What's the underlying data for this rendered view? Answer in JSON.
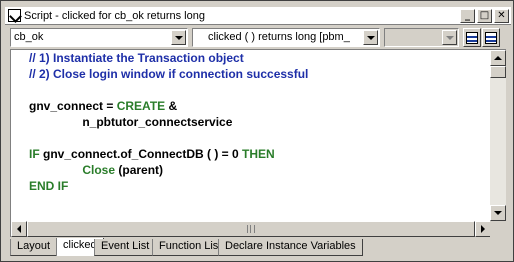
{
  "window": {
    "title": "Script - clicked for cb_ok returns long",
    "controls": {
      "minimize": "_",
      "maximize": "□",
      "close": "✕"
    }
  },
  "selectors": {
    "object": "cb_ok",
    "event": "clicked ( )  returns long [pbm_",
    "third": ""
  },
  "code": {
    "lines": [
      {
        "text": "// 1) Instantiate the Transaction object",
        "style": "comment"
      },
      {
        "text": "// 2) Close login window if connection successful",
        "style": "comment"
      },
      {
        "text": "",
        "style": "plain"
      },
      {
        "parts": [
          {
            "text": "gnv_connect = ",
            "style": "plain"
          },
          {
            "text": "CREATE",
            "style": "kw"
          },
          {
            "text": " &",
            "style": "plain"
          }
        ]
      },
      {
        "text": "                n_pbtutor_connectservice",
        "style": "plain"
      },
      {
        "text": "",
        "style": "plain"
      },
      {
        "parts": [
          {
            "text": "IF",
            "style": "kw"
          },
          {
            "text": " gnv_connect.of_ConnectDB ( ) = 0 ",
            "style": "plain"
          },
          {
            "text": "THEN",
            "style": "kw"
          }
        ]
      },
      {
        "parts": [
          {
            "text": "                Close",
            "style": "kw"
          },
          {
            "text": " (parent)",
            "style": "plain"
          }
        ]
      },
      {
        "text": "END IF",
        "style": "kw"
      }
    ]
  },
  "tabs": [
    {
      "label": "Layout",
      "active": false
    },
    {
      "label": "clicked",
      "active": true
    },
    {
      "label": "Event List",
      "active": false
    },
    {
      "label": "Function List",
      "active": false
    },
    {
      "label": "Declare Instance Variables",
      "active": false
    }
  ],
  "colors": {
    "comment": "#1e2fa8",
    "keyword": "#2a7d2a",
    "plain": "#000000",
    "chrome": "#d4d0c8"
  },
  "icons": {
    "window": "script-icon",
    "view1": "script-view-icon",
    "view2": "script-view-icon"
  }
}
